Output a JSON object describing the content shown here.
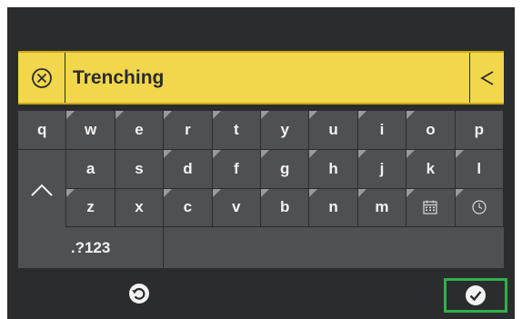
{
  "input": {
    "value": "Trenching"
  },
  "keyboard": {
    "row1": [
      "q",
      "w",
      "e",
      "r",
      "t",
      "y",
      "u",
      "i",
      "o",
      "p"
    ],
    "row2": [
      "a",
      "s",
      "d",
      "f",
      "g",
      "h",
      "j",
      "k",
      "l"
    ],
    "row3": [
      "z",
      "x",
      "c",
      "v",
      "b",
      "n",
      "m"
    ],
    "mode_key": ".?123"
  },
  "icons": {
    "clear": "clear-circle-x-icon",
    "backspace": "chevron-left-icon",
    "shift": "chevron-up-icon",
    "calendar": "calendar-icon",
    "clock": "clock-icon",
    "reset": "reset-icon",
    "confirm": "check-circle-icon"
  },
  "colors": {
    "accent_yellow": "#f2d64b",
    "key_bg": "#4f5052",
    "background": "#2b2c2e",
    "confirm_highlight": "#2fb14a"
  }
}
